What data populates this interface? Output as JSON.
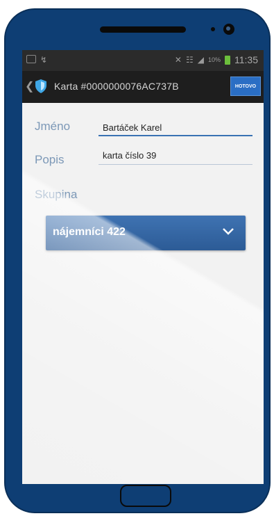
{
  "statusbar": {
    "time": "11:35",
    "battery_pct": "10%"
  },
  "actionbar": {
    "back_icon": "chevron-left-icon",
    "app_icon": "shield-icon",
    "title": "Karta #0000000076AC737B",
    "ok_label": "HOTOVO"
  },
  "form": {
    "name_label": "Jméno",
    "name_value": "Bartáček Karel",
    "desc_label": "Popis",
    "desc_value": "karta číslo 39",
    "group_label": "Skupina",
    "group_selected": "nájemníci 422"
  },
  "colors": {
    "frame": "#0e3e74",
    "accent": "#2a6ec4",
    "label": "#7c98b7",
    "dropdown": "#2c5b96"
  }
}
